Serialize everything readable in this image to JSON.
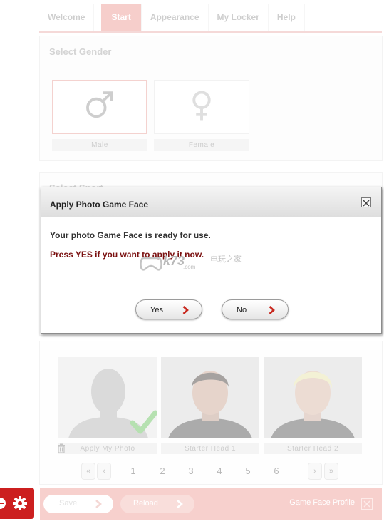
{
  "tabs": [
    {
      "label": "Welcome",
      "active": false
    },
    {
      "label": "Start",
      "active": true
    },
    {
      "label": "Appearance",
      "active": false
    },
    {
      "label": "My Locker",
      "active": false
    },
    {
      "label": "Help",
      "active": false
    }
  ],
  "gender_panel": {
    "title": "Select Gender",
    "options": [
      {
        "label": "Male",
        "icon": "male-symbol-icon",
        "selected": true
      },
      {
        "label": "Female",
        "icon": "female-symbol-icon",
        "selected": false
      }
    ]
  },
  "sport_panel": {
    "title": "Select Sport"
  },
  "heads": [
    {
      "label": "Apply My Photo",
      "icon": "checkmark-icon"
    },
    {
      "label": "Starter Head 1"
    },
    {
      "label": "Starter Head 2"
    }
  ],
  "pager": {
    "first": "«",
    "prev": "‹",
    "next": "›",
    "last": "»",
    "pages": [
      "1",
      "2",
      "3",
      "4",
      "5",
      "6"
    ]
  },
  "footer": {
    "save_label": "Save",
    "reload_label": "Reload",
    "profile_label": "Game Face Profile"
  },
  "dialog": {
    "title": "Apply Photo Game Face",
    "message": "Your photo Game Face is ready for use.",
    "warning": "Press YES if you want to apply it now.",
    "yes_label": "Yes",
    "no_label": "No"
  },
  "watermark": {
    "text": "k73",
    "sub": "电玩之家",
    "url": ".com"
  },
  "colors": {
    "accent": "#ec8c86",
    "footer": "#ee908a",
    "warning_text": "#7a1010",
    "side_tab": "#cc1f1f"
  }
}
